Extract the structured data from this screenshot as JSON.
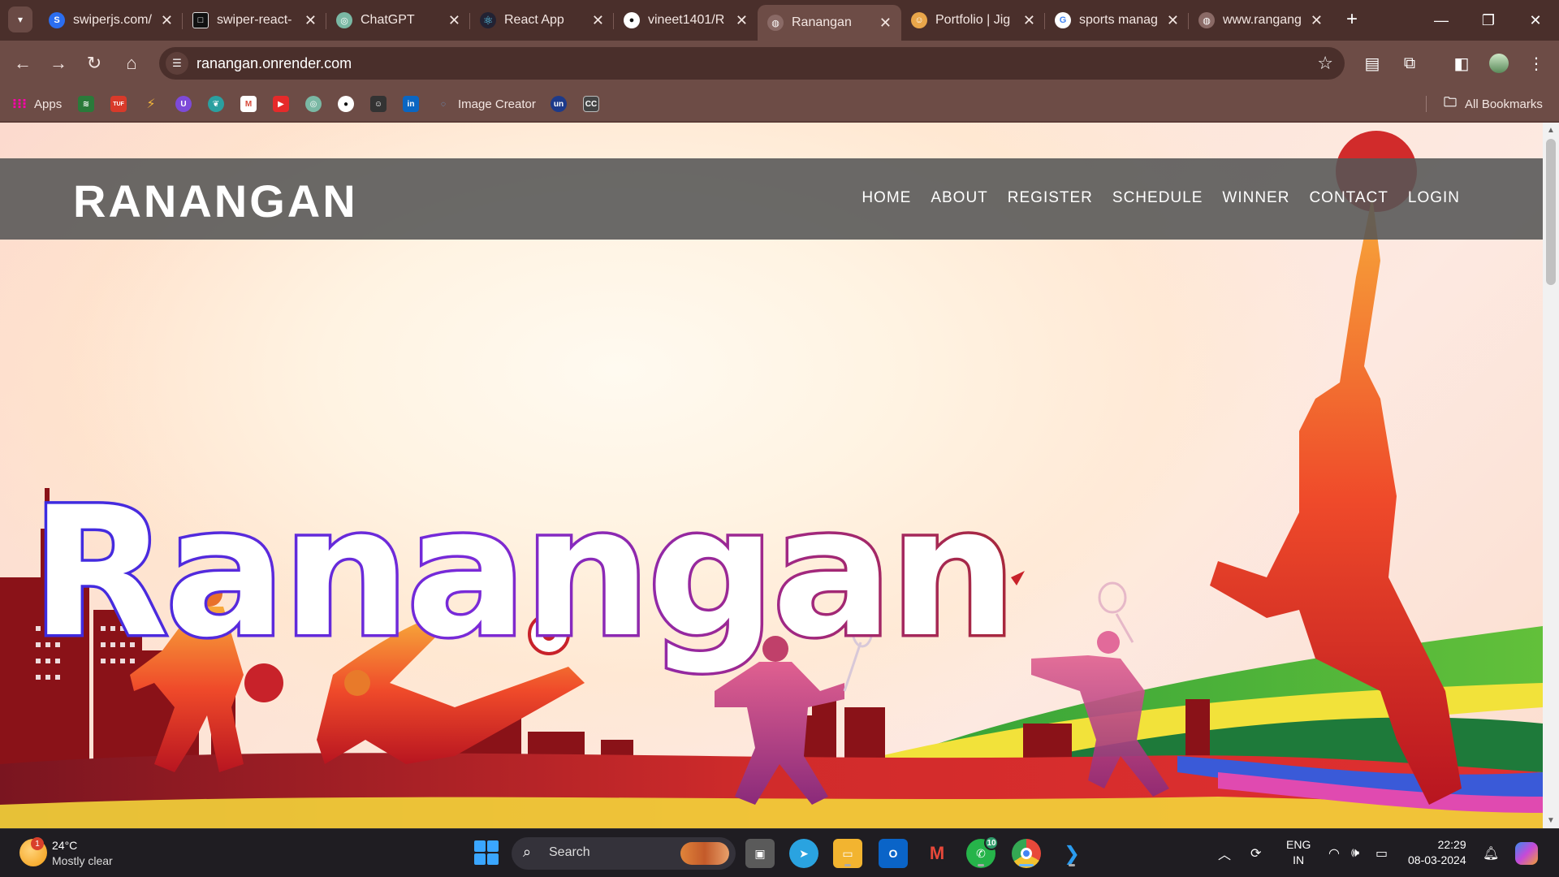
{
  "browser": {
    "tabs": [
      {
        "title": "swiperjs.com/",
        "icon": "swiper-icon",
        "color": "#2b6ef0",
        "glyph": "S"
      },
      {
        "title": "swiper-react-",
        "icon": "code-sandbox-icon",
        "color": "#111111",
        "glyph": "□"
      },
      {
        "title": "ChatGPT",
        "icon": "chatgpt-icon",
        "color": "#7ab8a4",
        "glyph": "◎"
      },
      {
        "title": "React App",
        "icon": "react-icon",
        "color": "#233",
        "glyph": "⚛"
      },
      {
        "title": "vineet1401/R",
        "icon": "github-icon",
        "color": "#111111",
        "glyph": "●"
      },
      {
        "title": "Ranangan",
        "icon": "globe-icon",
        "color": "#8a6a66",
        "glyph": "◍",
        "active": true
      },
      {
        "title": "Portfolio | Jig",
        "icon": "portfolio-icon",
        "color": "#e9a64a",
        "glyph": "☺"
      },
      {
        "title": "sports manag",
        "icon": "google-icon",
        "color": "#ffffff",
        "glyph": "G"
      },
      {
        "title": "www.rangang",
        "icon": "globe-icon",
        "color": "#8a6a66",
        "glyph": "◍"
      }
    ],
    "url": "ranangan.onrender.com",
    "bookmarks": {
      "apps_label": "Apps",
      "image_creator_label": "Image Creator",
      "all_bookmarks_label": "All Bookmarks",
      "icons": [
        {
          "name": "bookmark-green-icon",
          "color": "#2a7a3a",
          "glyph": "≋"
        },
        {
          "name": "bookmark-tuf-icon",
          "color": "#d83a2a",
          "glyph": "TUF"
        },
        {
          "name": "bookmark-codeforces-icon",
          "color": "#111111",
          "glyph": "⚡"
        },
        {
          "name": "bookmark-u-icon",
          "color": "#7d4ad8",
          "glyph": "U"
        },
        {
          "name": "bookmark-leaf-icon",
          "color": "#2aa0a0",
          "glyph": "❦"
        },
        {
          "name": "bookmark-gmail-icon",
          "color": "#d84a3a",
          "glyph": "M"
        },
        {
          "name": "bookmark-youtube-icon",
          "color": "#e52a2a",
          "glyph": "▶"
        },
        {
          "name": "bookmark-chatgpt-icon",
          "color": "#7ab8a4",
          "glyph": "◎"
        },
        {
          "name": "bookmark-github-icon",
          "color": "#111111",
          "glyph": "●"
        },
        {
          "name": "bookmark-contact-icon",
          "color": "#333333",
          "glyph": "☺"
        },
        {
          "name": "bookmark-linkedin-icon",
          "color": "#0a66c2",
          "glyph": "in"
        }
      ]
    }
  },
  "site": {
    "brand": "RANANGAN",
    "menu": [
      "HOME",
      "ABOUT",
      "REGISTER",
      "SCHEDULE",
      "WINNER",
      "CONTACT",
      "LOGIN"
    ],
    "hero_title": "Ranangan"
  },
  "taskbar": {
    "weather_temp": "24°C",
    "weather_desc": "Mostly clear",
    "weather_badge": "1",
    "search_label": "Search",
    "whatsapp_badge": "10",
    "lang_top": "ENG",
    "lang_bottom": "IN",
    "time": "22:29",
    "date": "08-03-2024"
  }
}
